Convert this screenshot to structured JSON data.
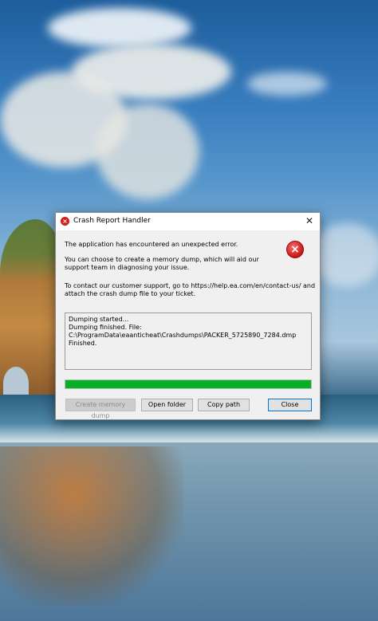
{
  "dialog": {
    "title": "Crash Report Handler",
    "message_1": "The application has encountered an unexpected error.",
    "message_2": "You can choose to create a memory dump, which will aid our support team in diagnosing your issue.",
    "message_3": "To contact our customer support, go to https://help.ea.com/en/contact-us/ and attach the crash dump file to your ticket.",
    "log_lines": [
      "Dumping started...",
      "Dumping finished. File:",
      "C:\\ProgramData\\eaanticheat\\Crashdumps\\PACKER_5725890_7284.dmp",
      "Finished."
    ],
    "progress_percent": 100,
    "buttons": {
      "create_dump": "Create memory dump",
      "open_folder": "Open folder",
      "copy_path": "Copy path",
      "close": "Close"
    },
    "icons": {
      "title": "error-icon",
      "message": "error-icon",
      "close": "close-icon"
    },
    "colors": {
      "progress": "#06b025",
      "error": "#d41c1c"
    }
  }
}
